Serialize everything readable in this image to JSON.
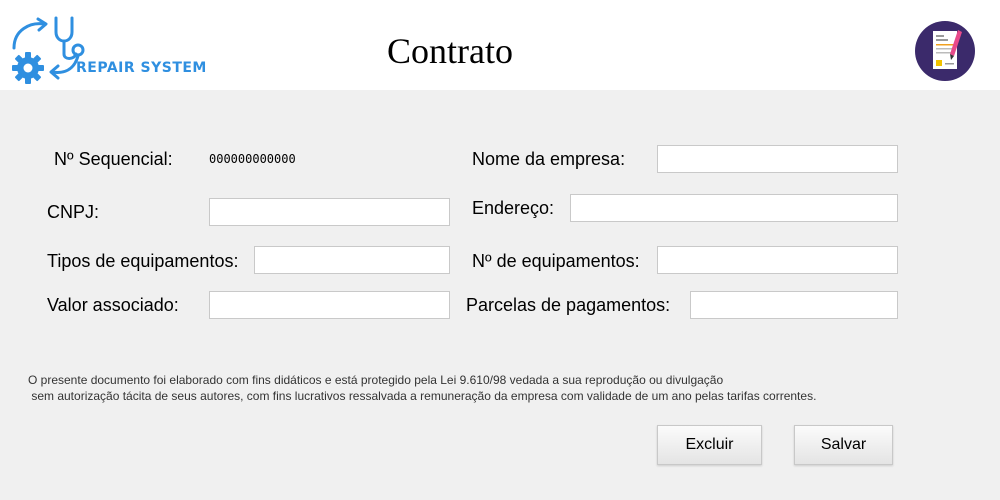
{
  "header": {
    "logo_text": "REPAIR SYSTEM",
    "title": "Contrato"
  },
  "form": {
    "sequencial": {
      "label": "Nº Sequencial:",
      "value": "000000000000"
    },
    "nome_empresa": {
      "label": "Nome da empresa:",
      "value": ""
    },
    "cnpj": {
      "label": "CNPJ:",
      "value": ""
    },
    "endereco": {
      "label": "Endereço:",
      "value": ""
    },
    "tipos_equipamentos": {
      "label": "Tipos de equipamentos:",
      "value": ""
    },
    "num_equipamentos": {
      "label": "Nº de equipamentos:",
      "value": ""
    },
    "valor_associado": {
      "label": "Valor associado:",
      "value": ""
    },
    "parcelas": {
      "label": "Parcelas de pagamentos:",
      "value": ""
    }
  },
  "notice": {
    "line1": "O presente documento foi elaborado com fins didáticos e está protegido pela Lei 9.610/98 vedada a sua reprodução ou divulgação",
    "line2": " sem autorização tácita de seus autores, com fins lucrativos ressalvada a remuneração da empresa com validade de um ano pelas tarifas correntes."
  },
  "actions": {
    "delete_label": "Excluir",
    "save_label": "Salvar"
  },
  "colors": {
    "logo_blue": "#2f8fe0",
    "badge_purple": "#3b2a6b"
  },
  "icons": {
    "logo": "gear-stethoscope-icon",
    "badge": "contract-document-icon"
  }
}
